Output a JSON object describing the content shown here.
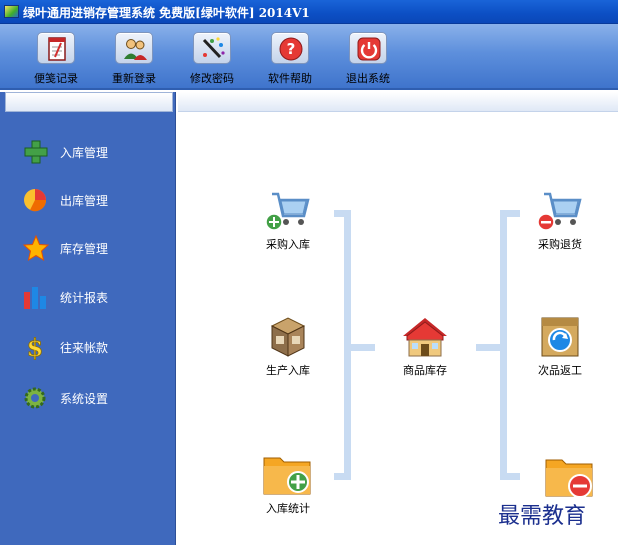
{
  "window": {
    "title": "绿叶通用进销存管理系统 免费版[绿叶软件] 2014V1"
  },
  "toolbar": {
    "items": [
      {
        "label": "便笺记录",
        "icon": "notepad-icon"
      },
      {
        "label": "重新登录",
        "icon": "users-icon"
      },
      {
        "label": "修改密码",
        "icon": "password-icon"
      },
      {
        "label": "软件帮助",
        "icon": "help-icon"
      },
      {
        "label": "退出系统",
        "icon": "power-icon"
      }
    ]
  },
  "sidebar": {
    "items": [
      {
        "label": "入库管理",
        "icon": "green-plus-icon"
      },
      {
        "label": "出库管理",
        "icon": "pie-chart-icon"
      },
      {
        "label": "库存管理",
        "icon": "star-icon"
      },
      {
        "label": "统计报表",
        "icon": "bar-chart-icon"
      },
      {
        "label": "往来帐款",
        "icon": "dollar-icon"
      },
      {
        "label": "系统设置",
        "icon": "gear-icon"
      }
    ]
  },
  "flow": {
    "purchase_in": "采购入库",
    "production_in": "生产入库",
    "inbound_stats": "入库统计",
    "inventory": "商品库存",
    "purchase_return": "采购退货",
    "defect_rework": "次品返工"
  },
  "watermark": "最需教育"
}
